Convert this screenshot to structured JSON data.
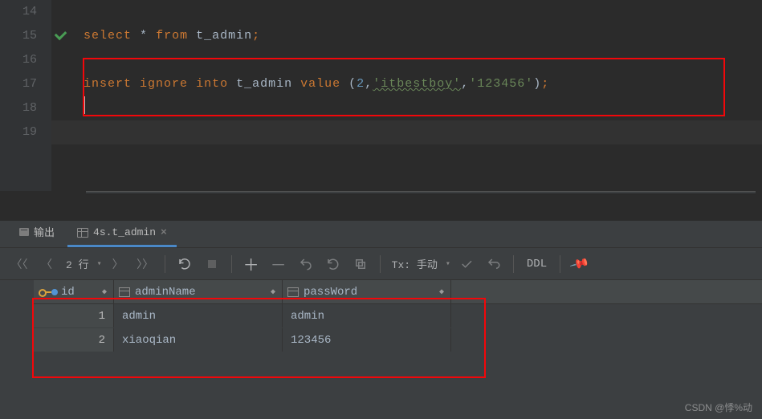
{
  "editor": {
    "lines": [
      "14",
      "15",
      "16",
      "17",
      "18",
      "19"
    ],
    "sql1": {
      "select": "select",
      "star": "*",
      "from": "from",
      "tbl": "t_admin",
      "semi": ";"
    },
    "sql2": {
      "insert": "insert",
      "ignore": "ignore",
      "into": "into",
      "tbl": "t_admin",
      "value": "value",
      "lp": "(",
      "n": "2",
      "c1": ",",
      "s1": "'itbestboy'",
      "c2": ",",
      "s2": "'123456'",
      "rp": ")",
      "semi": ";"
    }
  },
  "tabs": {
    "output": "输出",
    "table": "4s.t_admin"
  },
  "toolbar": {
    "rows_label": "2 行",
    "tx_label": "Tx: 手动",
    "ddl": "DDL"
  },
  "columns": {
    "id": "id",
    "adminName": "adminName",
    "passWord": "passWord"
  },
  "data": {
    "rows": [
      {
        "n": "1",
        "id": "1",
        "adminName": "admin",
        "passWord": "admin"
      },
      {
        "n": "2",
        "id": "2",
        "adminName": "xiaoqian",
        "passWord": "123456"
      }
    ]
  },
  "watermark": "CSDN @悸%动"
}
